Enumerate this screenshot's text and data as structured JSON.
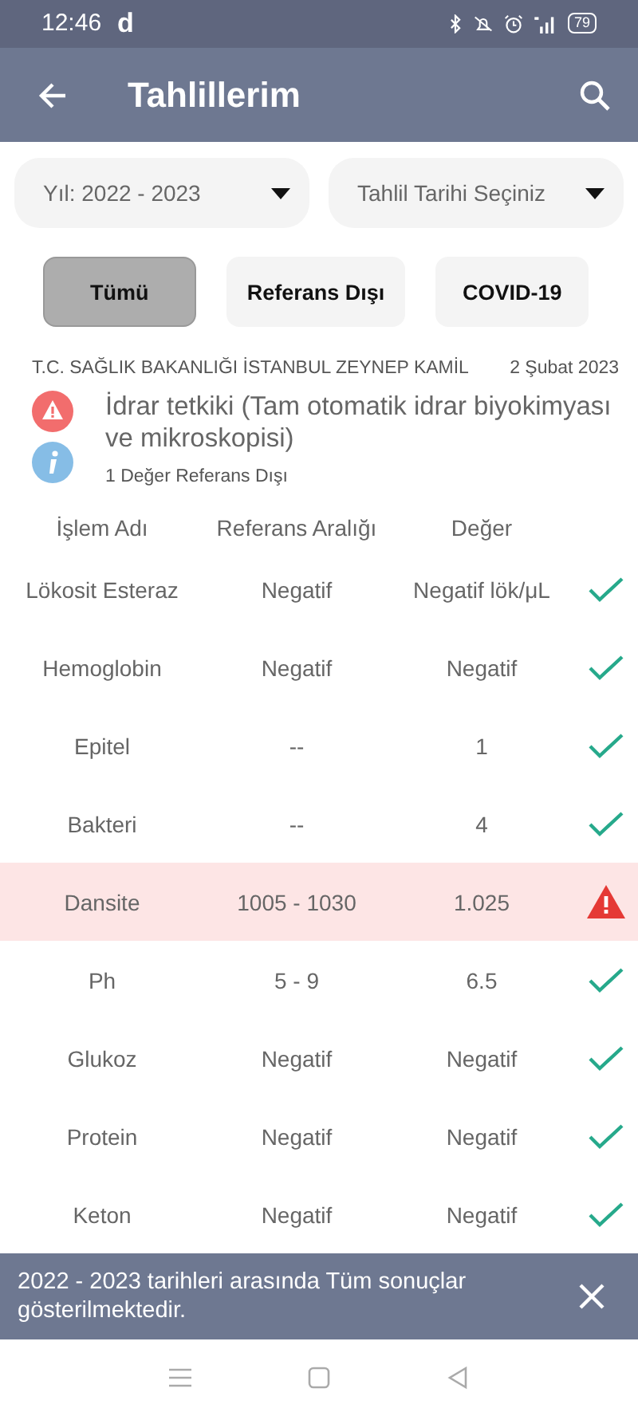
{
  "status_bar": {
    "time": "12:46",
    "app_letter": "d",
    "battery": "79"
  },
  "app_bar": {
    "title": "Tahlillerim"
  },
  "dropdowns": [
    {
      "value": "Yıl: 2022 - 2023"
    },
    {
      "value": "Tahlil Tarihi Seçiniz"
    }
  ],
  "filters": [
    {
      "label": "Tümü",
      "selected": true
    },
    {
      "label": "Referans Dışı",
      "selected": false
    },
    {
      "label": "COVID-19",
      "selected": false
    }
  ],
  "report": {
    "institution": "T.C. SAĞLIK BAKANLIĞI İSTANBUL ZEYNEP KAMİL",
    "date": "2 Şubat 2023",
    "title": "İdrar tetkiki (Tam otomatik idrar biyokimyası ve mikroskopisi)",
    "summary": "1 Değer Referans Dışı",
    "has_warning": true
  },
  "table": {
    "columns": [
      "İşlem Adı",
      "Referans Aralığı",
      "Değer"
    ],
    "rows": [
      {
        "name": "Lökosit Esteraz",
        "range": "Negatif",
        "value": "Negatif lök/μL",
        "out_of_range": false
      },
      {
        "name": "Hemoglobin",
        "range": "Negatif",
        "value": "Negatif",
        "out_of_range": false
      },
      {
        "name": "Epitel",
        "range": "--",
        "value": "1",
        "out_of_range": false
      },
      {
        "name": "Bakteri",
        "range": "--",
        "value": "4",
        "out_of_range": false
      },
      {
        "name": "Dansite",
        "range": "1005 - 1030",
        "value": "1.025",
        "out_of_range": true
      },
      {
        "name": "Ph",
        "range": "5 - 9",
        "value": "6.5",
        "out_of_range": false
      },
      {
        "name": "Glukoz",
        "range": "Negatif",
        "value": "Negatif",
        "out_of_range": false
      },
      {
        "name": "Protein",
        "range": "Negatif",
        "value": "Negatif",
        "out_of_range": false
      },
      {
        "name": "Keton",
        "range": "Negatif",
        "value": "Negatif",
        "out_of_range": false
      }
    ]
  },
  "snackbar": {
    "message": "2022 - 2023 tarihleri arasında Tüm sonuçlar gösterilmektedir."
  }
}
